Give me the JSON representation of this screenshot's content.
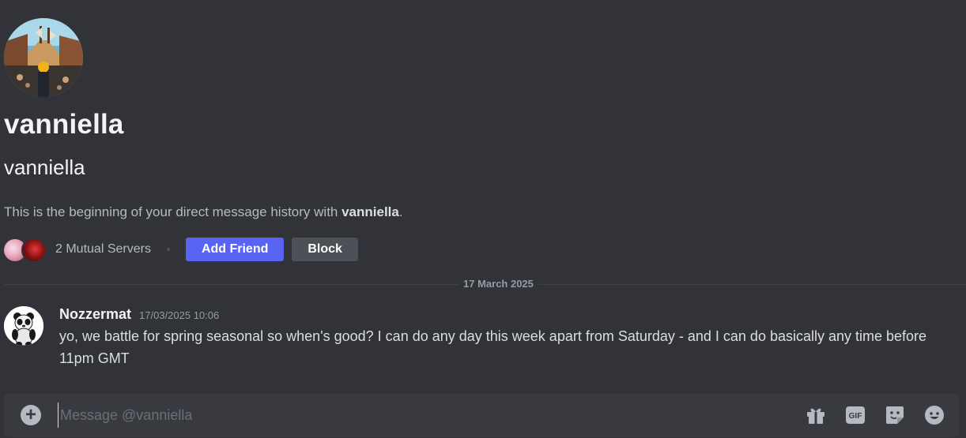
{
  "profile": {
    "display_name": "vanniella",
    "username": "vanniella",
    "intro_prefix": "This is the beginning of your direct message history with ",
    "intro_name": "vanniella",
    "intro_suffix": ".",
    "mutual_servers": "2 Mutual Servers",
    "add_friend_label": "Add Friend",
    "block_label": "Block"
  },
  "divider": {
    "date": "17 March 2025"
  },
  "messages": [
    {
      "author": "Nozzermat",
      "timestamp": "17/03/2025 10:06",
      "text": "yo, we battle for spring seasonal so when's good? I can do any day this week apart from Saturday - and I can do basically any time before 11pm GMT"
    }
  ],
  "composer": {
    "placeholder": "Message @vanniella",
    "icons": [
      "add-icon",
      "gift-icon",
      "gif-icon",
      "sticker-icon",
      "emoji-icon"
    ],
    "gif_label": "GIF"
  },
  "colors": {
    "background": "#313338",
    "composer_bg": "#383a40",
    "primary_button": "#5865f2",
    "secondary_button": "#4e5058",
    "muted_text": "#949ba4"
  }
}
